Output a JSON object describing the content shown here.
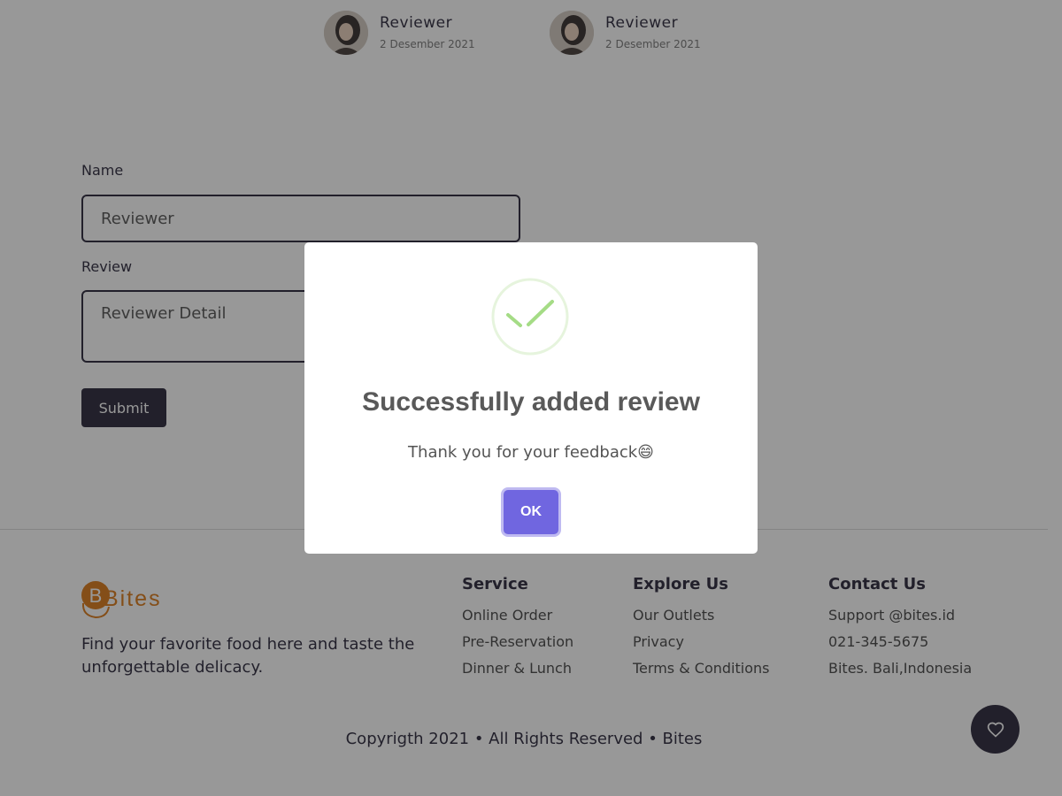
{
  "reviews": [
    {
      "name": "Reviewer",
      "date": "2 Desember 2021"
    },
    {
      "name": "Reviewer",
      "date": "2 Desember 2021"
    }
  ],
  "form": {
    "name_label": "Name",
    "name_placeholder": "Reviewer",
    "review_label": "Review",
    "review_placeholder": "Reviewer Detail",
    "submit_label": "Submit"
  },
  "footer": {
    "logo_text": "Bites",
    "tagline": "Find your favorite food here and taste the unforgettable delicacy.",
    "columns": [
      {
        "title": "Service",
        "links": [
          "Online Order",
          "Pre-Reservation",
          "Dinner & Lunch"
        ]
      },
      {
        "title": "Explore Us",
        "links": [
          "Our Outlets",
          "Privacy",
          "Terms & Conditions"
        ]
      },
      {
        "title": "Contact Us",
        "links": [
          "Support @bites.id",
          "021-345-5675",
          "Bites. Bali,Indonesia"
        ]
      }
    ],
    "copyright": "Copyrigth 2021 • All Rights Reserved • Bites",
    "fab_icon": "heart-icon"
  },
  "modal": {
    "icon": "success-check-icon",
    "title": "Successfully added review",
    "text": "Thank you for your feedback😄",
    "ok_label": "OK"
  },
  "colors": {
    "dark": "#1d1a2f",
    "brand": "#d9720b",
    "confirm": "#7066e0",
    "success": "#a5dc86"
  }
}
